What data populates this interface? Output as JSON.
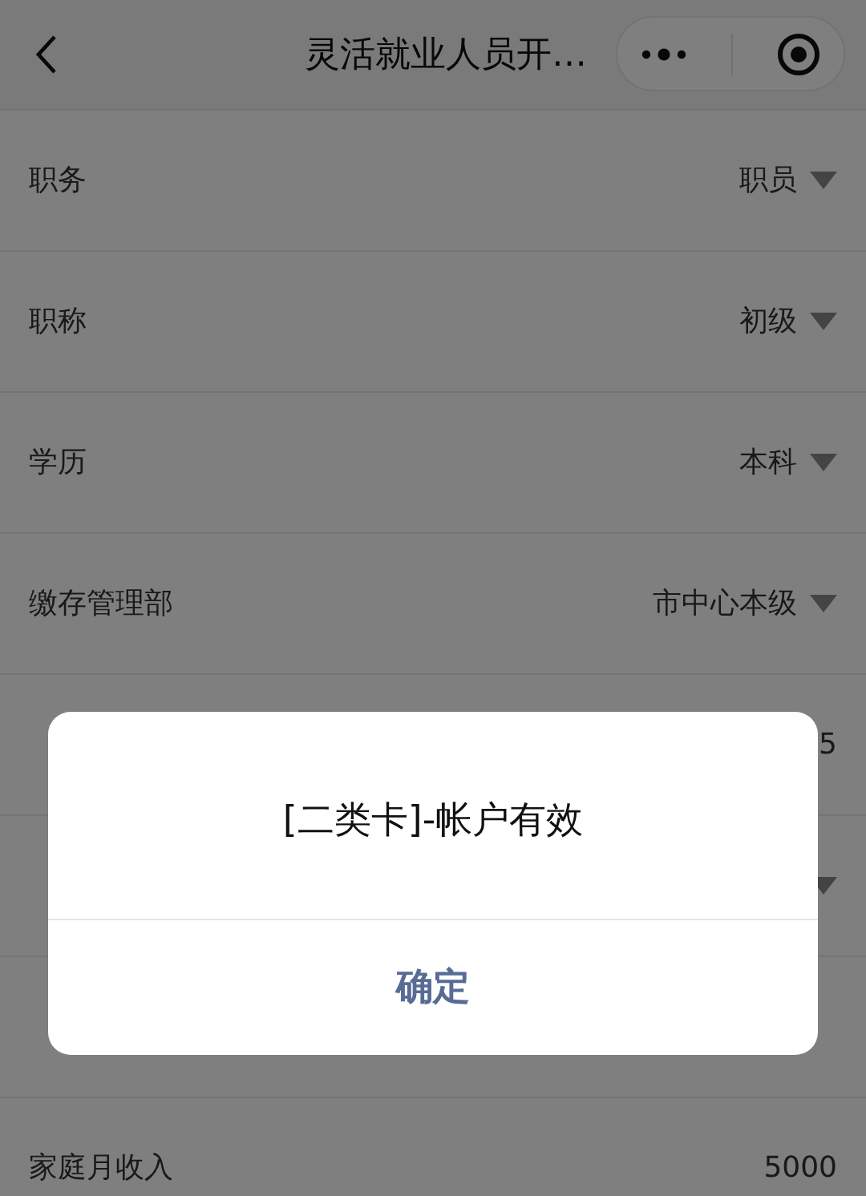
{
  "nav": {
    "title": "灵活就业人员开…"
  },
  "rows": [
    {
      "label": "职务",
      "value": "职员",
      "kind": "select"
    },
    {
      "label": "职称",
      "value": "初级",
      "kind": "select"
    },
    {
      "label": "学历",
      "value": "本科",
      "kind": "select"
    },
    {
      "label": "缴存管理部",
      "value": "市中心本级",
      "kind": "select"
    },
    {
      "value": "5",
      "kind": "text"
    },
    {
      "kind": "select"
    },
    {
      "kind": "text"
    },
    {
      "label": "家庭月收入",
      "value": "5000",
      "kind": "text"
    }
  ],
  "dialog": {
    "message": "[二类卡]-帐户有效",
    "button": "确定"
  }
}
